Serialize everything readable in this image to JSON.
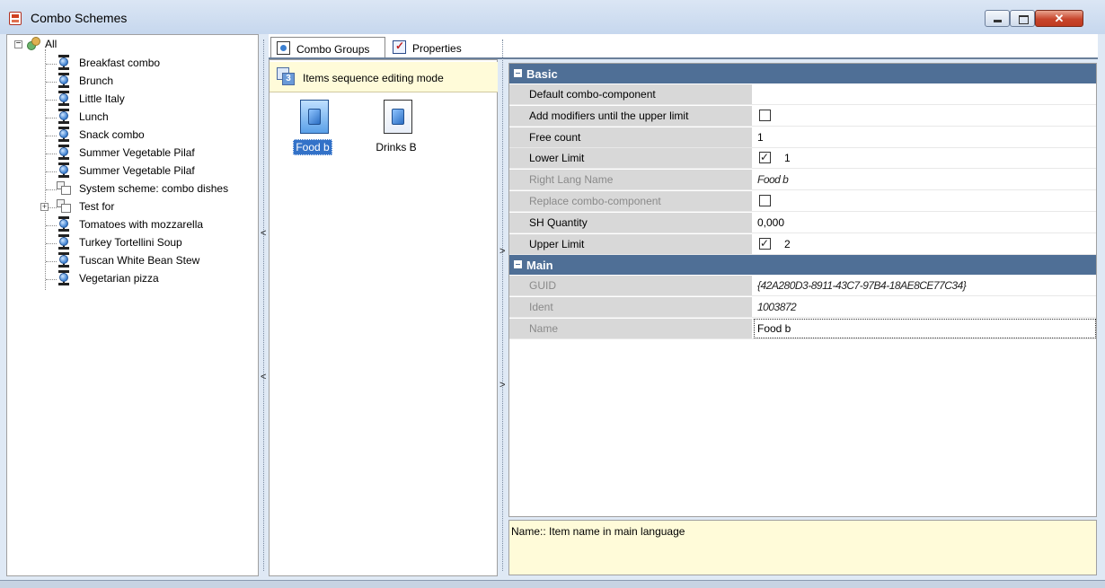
{
  "window": {
    "title": "Combo Schemes",
    "min_glyph": "",
    "max_glyph": "",
    "close_glyph": "✕"
  },
  "tree": {
    "root_label": "All",
    "items": [
      {
        "label": "Breakfast combo",
        "icon": "combo-node-icon"
      },
      {
        "label": "Brunch",
        "icon": "combo-node-icon"
      },
      {
        "label": "Little Italy",
        "icon": "combo-node-icon"
      },
      {
        "label": "Lunch",
        "icon": "combo-node-icon"
      },
      {
        "label": "Snack combo",
        "icon": "combo-node-icon"
      },
      {
        "label": "Summer Vegetable Pilaf",
        "icon": "combo-node-icon"
      },
      {
        "label": "Summer Vegetable Pilaf",
        "icon": "combo-node-icon"
      },
      {
        "label": "System scheme: combo dishes",
        "icon": "folder-icon"
      },
      {
        "label": "Test for",
        "icon": "folder-icon",
        "expandable": true
      },
      {
        "label": "Tomatoes with mozzarella",
        "icon": "combo-node-icon"
      },
      {
        "label": "Turkey Tortellini Soup",
        "icon": "combo-node-icon"
      },
      {
        "label": "Tuscan White Bean Stew",
        "icon": "combo-node-icon"
      },
      {
        "label": "Vegetarian pizza",
        "icon": "combo-node-icon"
      }
    ]
  },
  "tabs": [
    {
      "label": "Combo Groups",
      "active": true
    },
    {
      "label": "Properties",
      "active": false
    }
  ],
  "groups_panel": {
    "sequence_mode_label": "Items sequence editing mode",
    "sequence_badge": "3",
    "items": [
      {
        "label": "Food b",
        "selected": true
      },
      {
        "label": "Drinks B",
        "selected": false
      }
    ]
  },
  "properties": {
    "basic": {
      "title": "Basic",
      "rows": [
        {
          "name": "Default combo-component",
          "value": "",
          "readonly": false
        },
        {
          "name": "Add modifiers until the upper limit",
          "checkbox": false,
          "readonly": false
        },
        {
          "name": "Free count",
          "value": "1",
          "readonly": false
        },
        {
          "name": "Lower Limit",
          "checkbox": true,
          "value": "1",
          "readonly": false
        },
        {
          "name": "Right Lang Name",
          "value": "Food b",
          "readonly": true,
          "italic": true
        },
        {
          "name": "Replace combo-component",
          "checkbox": false,
          "readonly": true
        },
        {
          "name": "SH Quantity",
          "value": "0,000",
          "readonly": false
        },
        {
          "name": "Upper Limit",
          "checkbox": true,
          "value": "2",
          "readonly": false
        }
      ]
    },
    "main": {
      "title": "Main",
      "rows": [
        {
          "name": "GUID",
          "value": "{42A280D3-8911-43C7-97B4-18AE8CE77C34}",
          "readonly": true,
          "italic": true
        },
        {
          "name": "Ident",
          "value": "1003872",
          "readonly": true,
          "italic": true
        },
        {
          "name": "Name",
          "value": "Food b",
          "readonly": true,
          "editing": true
        }
      ]
    }
  },
  "description": "Name:: Item name in main language",
  "splitters": {
    "left_arrow": "<",
    "right_arrow": ">"
  }
}
